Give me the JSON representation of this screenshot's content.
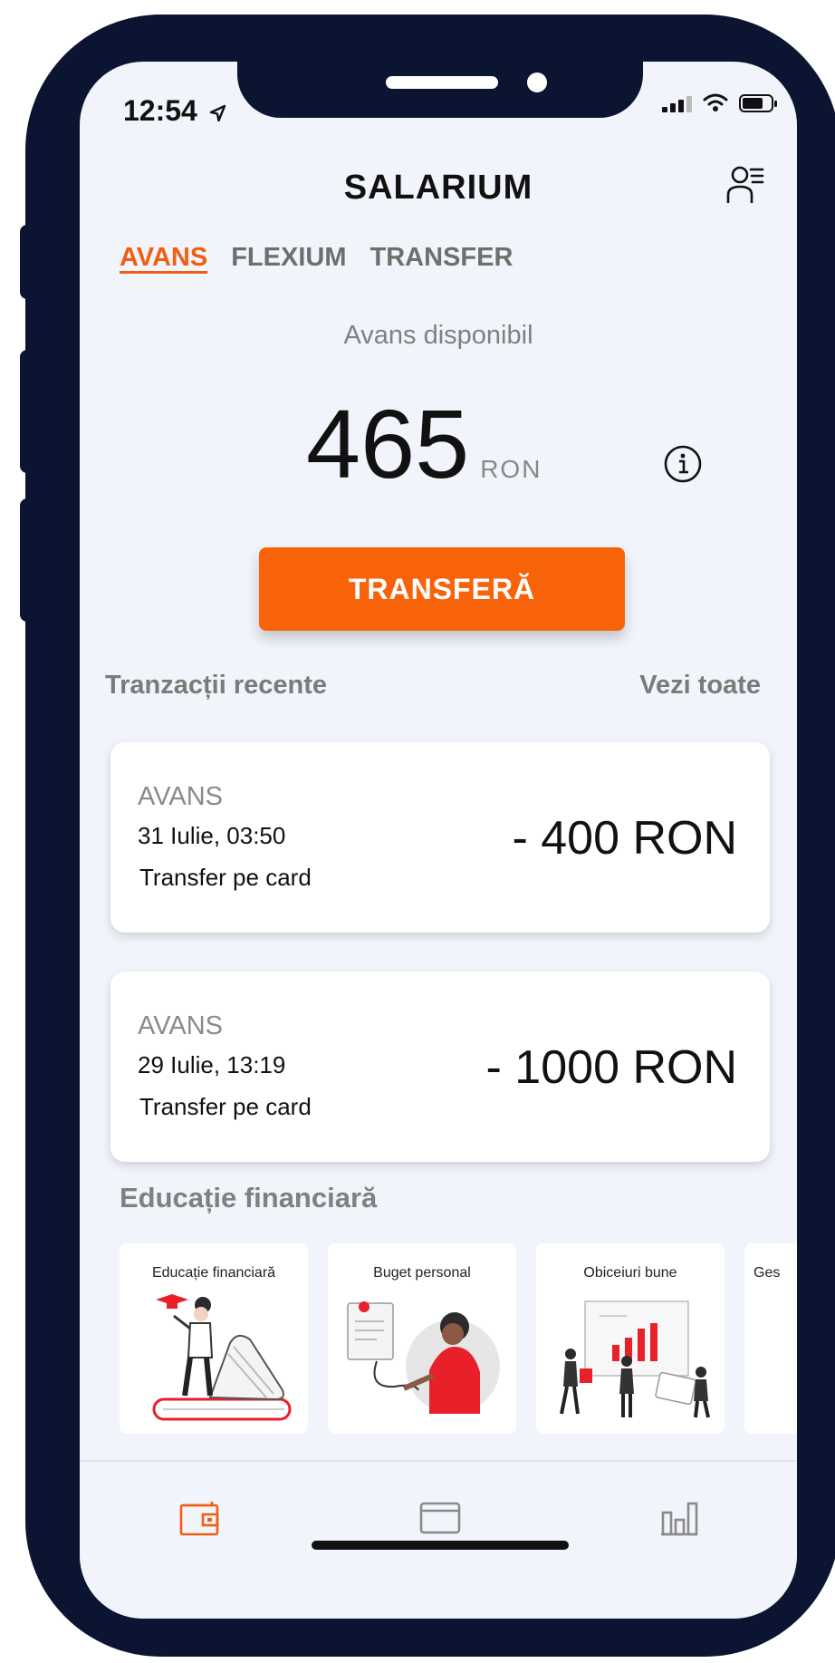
{
  "status_bar": {
    "time": "12:54"
  },
  "header": {
    "title": "SALARIUM"
  },
  "tabs": [
    {
      "label": "AVANS",
      "active": true
    },
    {
      "label": "FLEXIUM",
      "active": false
    },
    {
      "label": "TRANSFER",
      "active": false
    }
  ],
  "balance": {
    "label": "Avans disponibil",
    "amount": "465",
    "currency": "RON"
  },
  "primary_action": {
    "label": "TRANSFERĂ"
  },
  "recent": {
    "title": "Tranzacții recente",
    "see_all": "Vezi toate"
  },
  "transactions": [
    {
      "type": "AVANS",
      "date": "31 Iulie, 03:50",
      "method": "Transfer pe card",
      "amount": "- 400 RON"
    },
    {
      "type": "AVANS",
      "date": "29 Iulie, 13:19",
      "method": "Transfer pe card",
      "amount": "- 1000 RON"
    }
  ],
  "education": {
    "title": "Educație financiară",
    "cards": [
      {
        "label": "Educație financiară"
      },
      {
        "label": "Buget personal"
      },
      {
        "label": "Obiceiuri bune"
      },
      {
        "label": "Ges"
      }
    ]
  },
  "colors": {
    "accent": "#f86208",
    "frame": "#0b1431",
    "background": "#f1f4fa",
    "illustration_red": "#e8202a"
  },
  "icons": [
    "location-arrow-icon",
    "signal-icon",
    "wifi-icon",
    "battery-icon",
    "profile-menu-icon",
    "info-icon",
    "wallet-icon",
    "card-icon",
    "chart-icon"
  ]
}
